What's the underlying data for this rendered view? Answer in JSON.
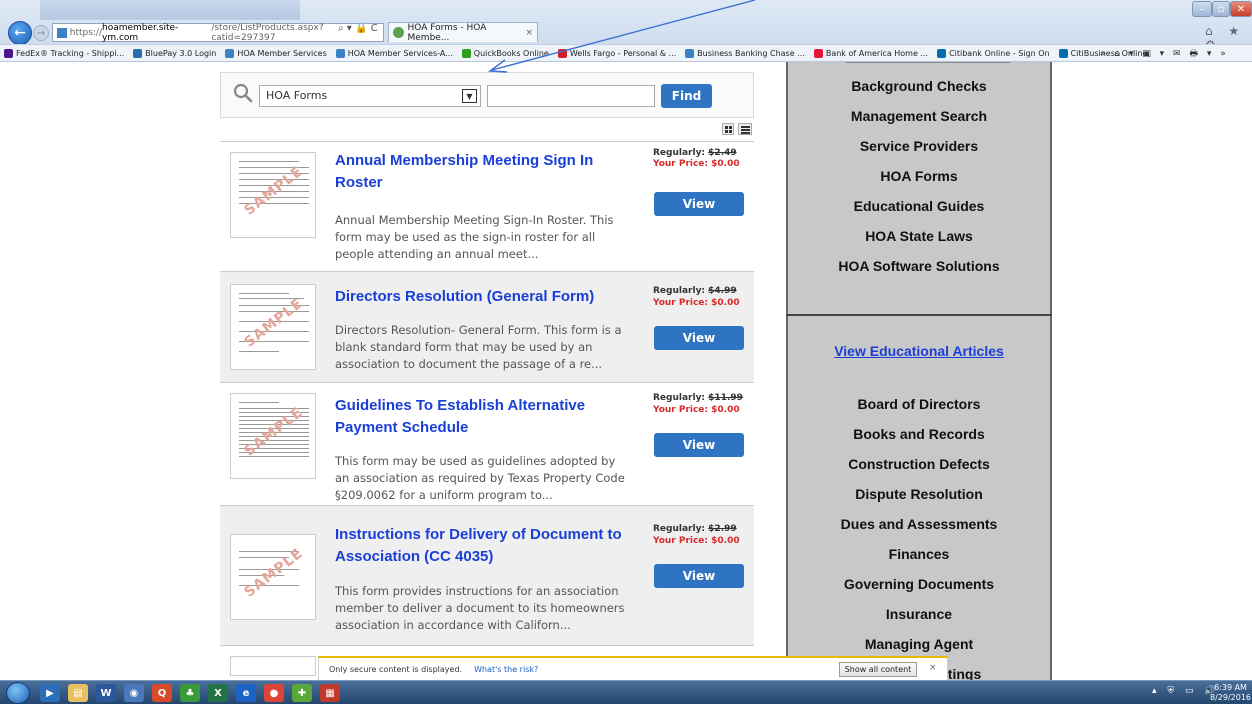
{
  "browser": {
    "url_prefix": "https://",
    "url_domain": "hoamember.site-ym.com",
    "url_path": "/store/ListProducts.aspx?catid=297397",
    "address_icons": "⌕ ▾ 🔒 C",
    "tab_title": "HOA Forms - HOA Membe...",
    "tab_close": "×",
    "right_icons": "⌂ ★ ⚙",
    "favorites": [
      {
        "label": "FedEx® Tracking - Shippi...",
        "color": "#4d148c"
      },
      {
        "label": "BluePay 3.0 Login",
        "color": "#2b6cb0"
      },
      {
        "label": "HOA Member Services",
        "color": "#3b82c4"
      },
      {
        "label": "HOA Member Services-A...",
        "color": "#3b82c4"
      },
      {
        "label": "QuickBooks Online",
        "color": "#2ca01c"
      },
      {
        "label": "Wells Fargo - Personal & ...",
        "color": "#d71e28"
      },
      {
        "label": "Business Banking Chase ...",
        "color": "#3b82c4"
      },
      {
        "label": "Bank of America Home ...",
        "color": "#e31837"
      },
      {
        "label": "Citibank Online - Sign On",
        "color": "#056dae"
      },
      {
        "label": "CitiBusiness Online",
        "color": "#056dae"
      }
    ],
    "fav_right": "» ⌂ ▾ ▣ ▾ ✉ 🖶 ▾ »"
  },
  "search": {
    "selected": "HOA Forms",
    "find_label": "Find"
  },
  "products": [
    {
      "title": "Annual Membership Meeting Sign In Roster",
      "desc": "Annual Membership Meeting Sign-In Roster.  This form may be used as the sign-in roster for all people attending an annual meet...",
      "regular_label": "Regularly:",
      "regular_price": "$2.49",
      "your_price": "Your Price: $0.00",
      "view_label": "View"
    },
    {
      "title": "Directors Resolution (General Form)",
      "desc": "Directors Resolution- General Form. This form is a blank standard form that may be used by an association to document the passage of a re...",
      "regular_label": "Regularly:",
      "regular_price": "$4.99",
      "your_price": "Your Price: $0.00",
      "view_label": "View"
    },
    {
      "title": "Guidelines To Establish Alternative Payment Schedule",
      "desc": "This form may be used as guidelines adopted by an association as required by Texas Property Code §209.0062 for a uniform program to...",
      "regular_label": "Regularly:",
      "regular_price": "$11.99",
      "your_price": "Your Price: $0.00",
      "view_label": "View"
    },
    {
      "title": "Instructions for Delivery of Document to Association (CC 4035)",
      "desc": "This form provides instructions for an association member to deliver a document to its homeowners association in accordance with Californ...",
      "regular_label": "Regularly:",
      "regular_price": "$2.99",
      "your_price": "Your Price: $0.00",
      "view_label": "View"
    }
  ],
  "thumb_watermark": "SAMPLE",
  "sidebar": {
    "top_links": [
      "Background Checks",
      "Management Search",
      "Service Providers",
      "HOA Forms",
      "Educational Guides",
      "HOA State Laws",
      "HOA Software Solutions"
    ],
    "articles_link": "View Educational Articles",
    "article_links": [
      "Board of Directors",
      "Books and Records",
      "Construction Defects",
      "Dispute Resolution",
      "Dues and Assessments",
      "Finances",
      "Governing Documents",
      "Insurance",
      "Managing Agent",
      "etings"
    ]
  },
  "notification": {
    "message": "Only secure content is displayed.",
    "risk_link": "What's the risk?",
    "show_all": "Show all content",
    "close": "×"
  },
  "taskbar": {
    "tray": "▴ ⛨ ▭ 🔊",
    "time": "6:39 AM",
    "date": "8/29/2016"
  }
}
